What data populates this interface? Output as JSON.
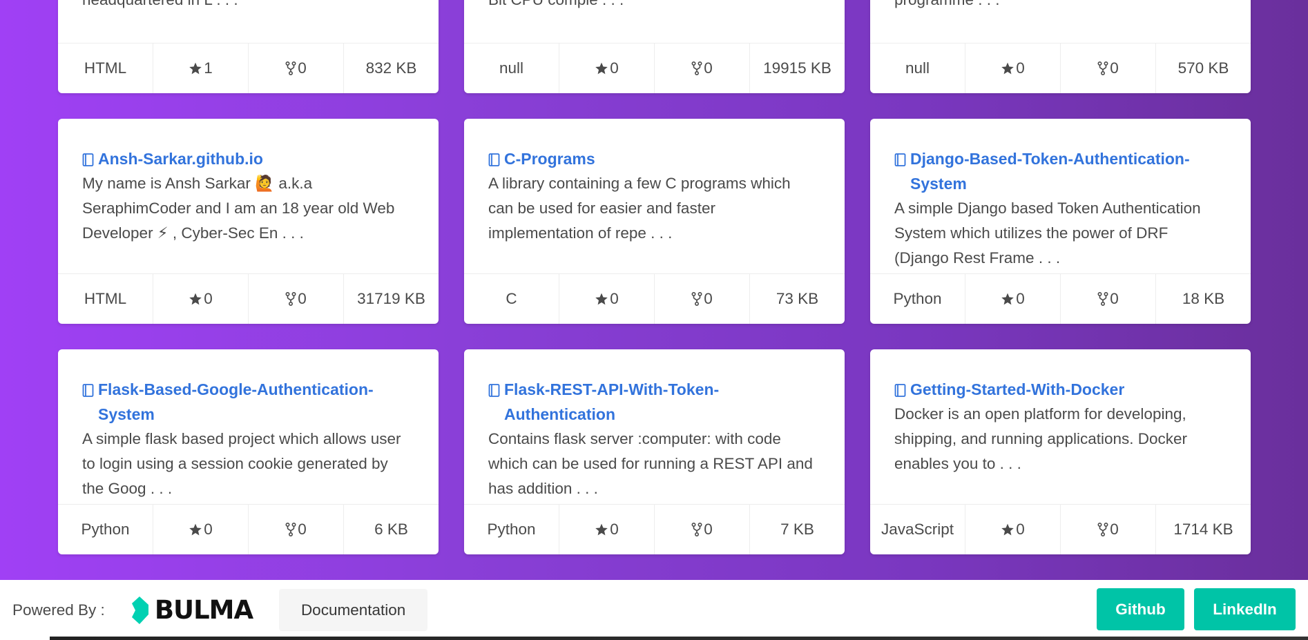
{
  "cards": [
    {
      "title": "",
      "description": "headquartered in L . . .",
      "language": "HTML",
      "stars": "1",
      "forks": "0",
      "size": "832 KB"
    },
    {
      "title": "",
      "description": "Bit CPU comple . . .",
      "language": "null",
      "stars": "0",
      "forks": "0",
      "size": "19915 KB"
    },
    {
      "title": "",
      "description": "programme . . .",
      "language": "null",
      "stars": "0",
      "forks": "0",
      "size": "570 KB"
    },
    {
      "title": "Ansh-Sarkar.github.io",
      "description": "My name is Ansh Sarkar 🙋 a.k.a SeraphimCoder and I am an 18 year old Web Developer ⚡ , Cyber-Sec En . . .",
      "language": "HTML",
      "stars": "0",
      "forks": "0",
      "size": "31719 KB"
    },
    {
      "title": "C-Programs",
      "description": "A library containing a few C programs which can be used for easier and faster implementation of repe . . .",
      "language": "C",
      "stars": "0",
      "forks": "0",
      "size": "73 KB"
    },
    {
      "title": "Django-Based-Token-Authentication-System",
      "description": "A simple Django based Token Authentication System which utilizes the power of DRF (Django Rest Frame . . .",
      "language": "Python",
      "stars": "0",
      "forks": "0",
      "size": "18 KB"
    },
    {
      "title": "Flask-Based-Google-Authentication-System",
      "description": "A simple flask based project which allows user to login using a session cookie generated by the Goog . . .",
      "language": "Python",
      "stars": "0",
      "forks": "0",
      "size": "6 KB"
    },
    {
      "title": "Flask-REST-API-With-Token-Authentication",
      "description": "Contains flask server :computer: with code which can be used for running a REST API and has addition . . .",
      "language": "Python",
      "stars": "0",
      "forks": "0",
      "size": "7 KB"
    },
    {
      "title": "Getting-Started-With-Docker",
      "description": "Docker is an open platform for developing, shipping, and running applications. Docker enables you to . . .",
      "language": "JavaScript",
      "stars": "0",
      "forks": "0",
      "size": "1714 KB"
    }
  ],
  "icons": {
    "repo": "book-icon",
    "star": "star-icon",
    "fork": "fork-icon"
  },
  "colors": {
    "link": "#3273dc",
    "accent": "#00c4a7",
    "gradient_start": "#a040f5",
    "gradient_end": "#6a2f9c"
  },
  "footer": {
    "powered_by": "Powered By :",
    "logo_text": "BULMA",
    "documentation": "Documentation",
    "github": "Github",
    "linkedin": "LinkedIn"
  }
}
